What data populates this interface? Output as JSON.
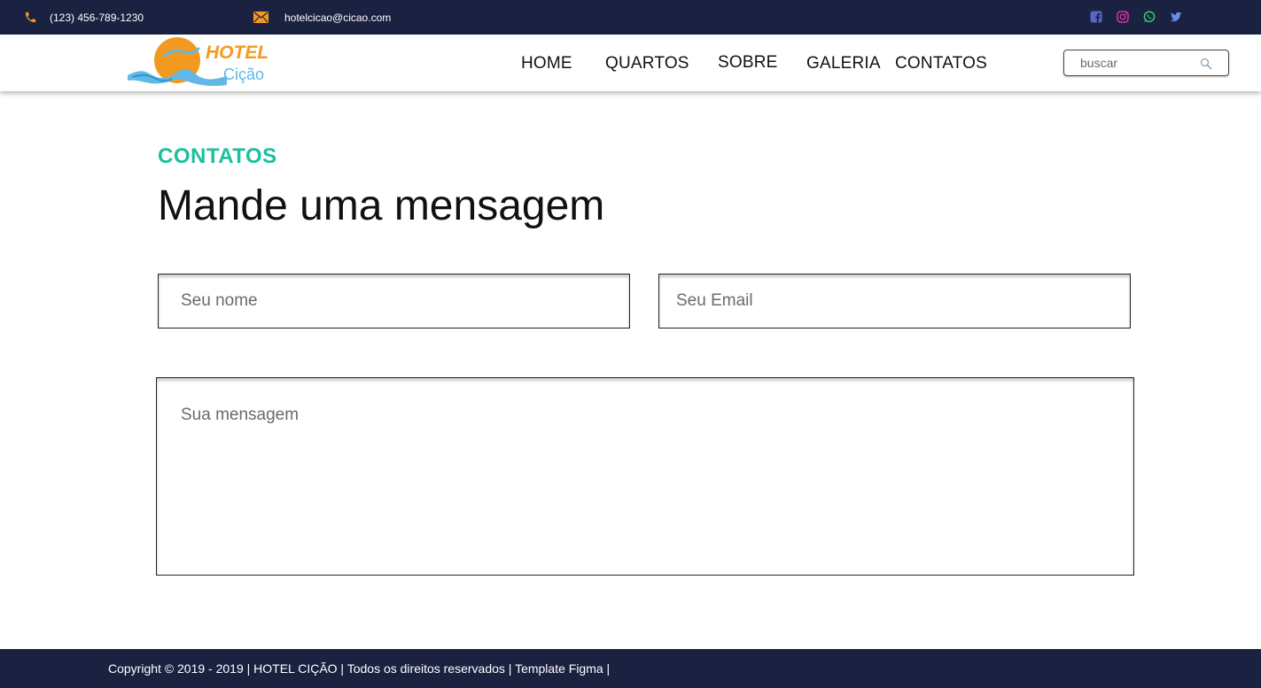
{
  "topbar": {
    "phone": "(123) 456-789-1230",
    "email": "hotelcicao@cicao.com",
    "phone_icon": "phone-icon",
    "mail_icon": "mail-icon",
    "socials": [
      "facebook-icon",
      "instagram-icon",
      "whatsapp-icon",
      "twitter-icon"
    ]
  },
  "header": {
    "logo": {
      "line1": "HOTEL",
      "line2": "Cição"
    },
    "nav": [
      "HOME",
      "QUARTOS",
      "SOBRE",
      "GALERIA",
      "CONTATOS"
    ],
    "search": {
      "placeholder": "buscar",
      "icon": "search-icon"
    }
  },
  "main": {
    "eyebrow": "CONTATOS",
    "title": "Mande uma mensagem",
    "form": {
      "name_placeholder": "Seu nome",
      "email_placeholder": "Seu Email",
      "message_placeholder": "Sua mensagem"
    }
  },
  "footer": {
    "copyright": "Copyright © 2019 - 2019 | HOTEL CIÇÃO | Todos os direitos reservados | Template Figma |"
  },
  "colors": {
    "dark_bar": "#1b2140",
    "accent": "#1cbf9e",
    "logo_orange": "#f29a1f",
    "logo_blue": "#5fb8e6"
  }
}
